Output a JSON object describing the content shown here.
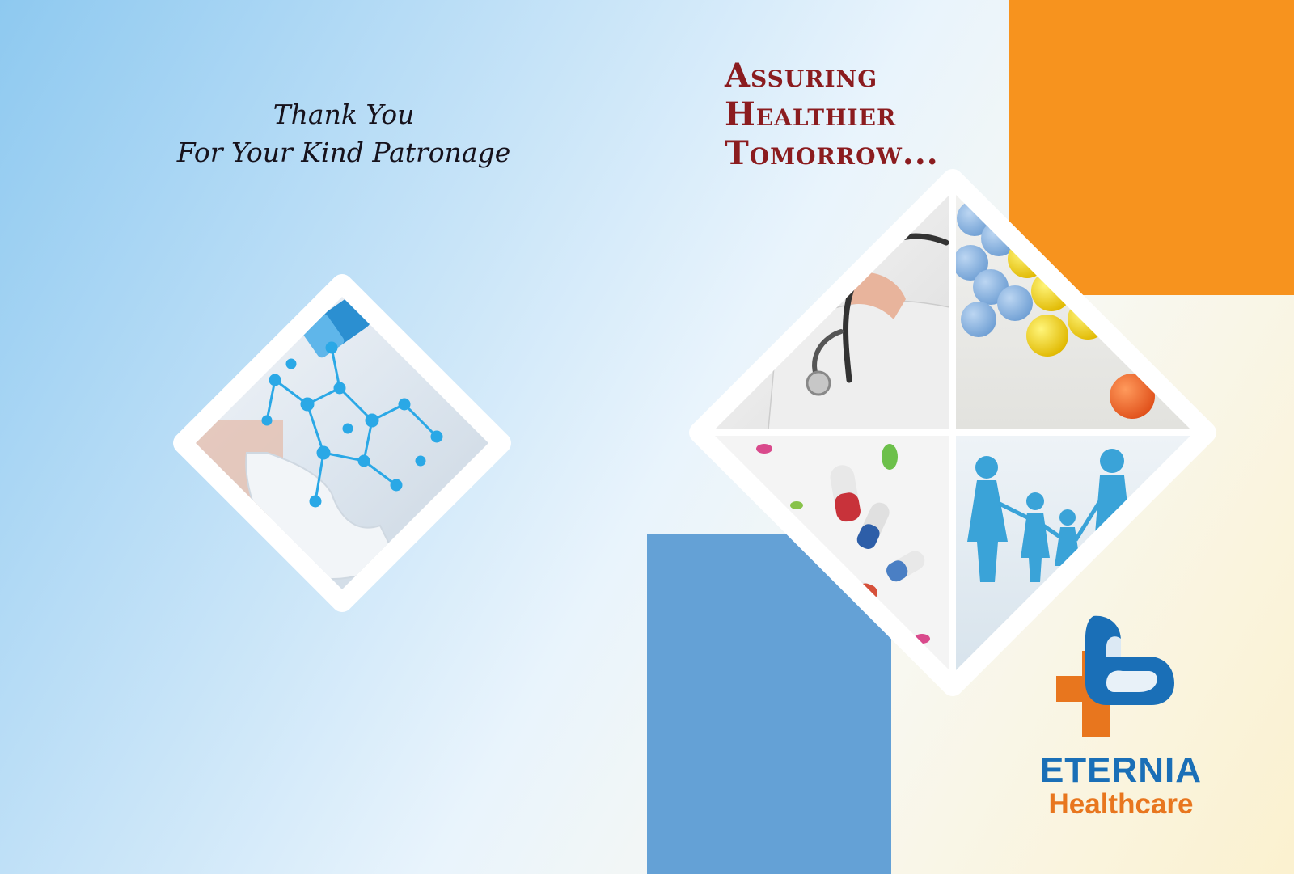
{
  "thanks": {
    "line1": "Thank You",
    "line2": "For Your Kind Patronage"
  },
  "tagline": {
    "line1": "Assuring",
    "line2": "Healthier",
    "line3": "Tomorrow..."
  },
  "logo": {
    "brand": "ETERNIA",
    "sub": "Healthcare"
  },
  "colors": {
    "orange": "#f7931e",
    "blue": "#64a1d6",
    "maroon": "#8b1c1f",
    "logo_blue": "#1a6fb7",
    "logo_orange": "#e8761e"
  },
  "icons": [
    "capsule-molecule-photo",
    "doctor-stethoscope-photo",
    "tablets-photo",
    "capsules-photo",
    "family-cutout-photo",
    "cross-logo-icon"
  ]
}
